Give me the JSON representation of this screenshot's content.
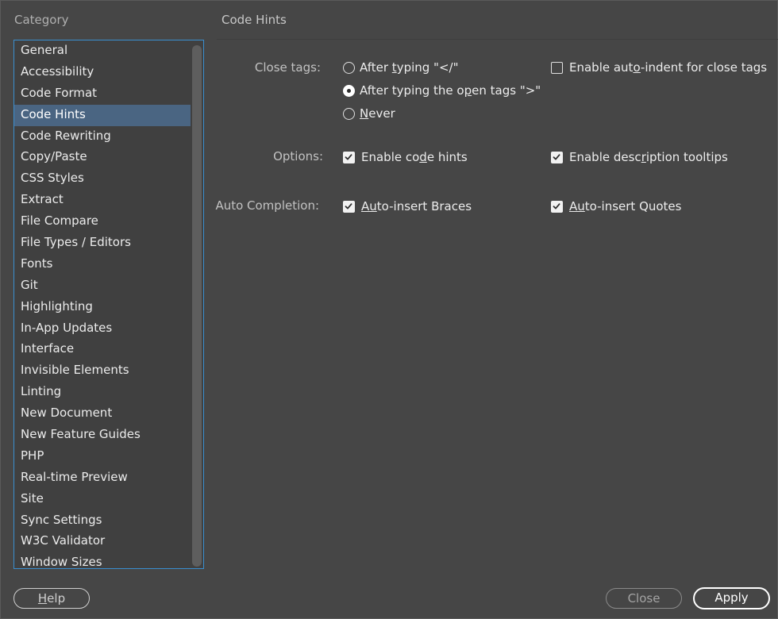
{
  "category_header": "Category",
  "section_title": "Code Hints",
  "categories": [
    "General",
    "Accessibility",
    "Code Format",
    "Code Hints",
    "Code Rewriting",
    "Copy/Paste",
    "CSS Styles",
    "Extract",
    "File Compare",
    "File Types / Editors",
    "Fonts",
    "Git",
    "Highlighting",
    "In-App Updates",
    "Interface",
    "Invisible Elements",
    "Linting",
    "New Document",
    "New Feature Guides",
    "PHP",
    "Real-time Preview",
    "Site",
    "Sync Settings",
    "W3C Validator",
    "Window Sizes"
  ],
  "selected_category": "Code Hints",
  "close_tags": {
    "label": "Close tags:",
    "opt1": {
      "pre": "After ",
      "u": "t",
      "post": "yping \"</\"",
      "checked": false
    },
    "opt2": {
      "pre": "After typing the o",
      "u": "p",
      "post": "en tags \">\"",
      "checked": true
    },
    "opt3": {
      "pre": "",
      "u": "N",
      "post": "ever",
      "checked": false
    },
    "auto_indent": {
      "pre": "Enable aut",
      "u": "o",
      "post": "-indent for close tags",
      "checked": false
    }
  },
  "options": {
    "label": "Options:",
    "code_hints": {
      "pre": "Enable co",
      "u": "d",
      "post": "e hints",
      "checked": true
    },
    "desc_tooltips": {
      "pre": "Enable desc",
      "u": "r",
      "post": "iption tooltips",
      "checked": true
    }
  },
  "auto_completion": {
    "label": "Auto Completion:",
    "braces": {
      "pre": "",
      "u": "Au",
      "post": "to-insert Braces",
      "checked": true
    },
    "quotes": {
      "pre": "",
      "u": "Au",
      "post": "to-insert Quotes",
      "checked": true
    }
  },
  "buttons": {
    "help": {
      "pre": "",
      "u": "H",
      "post": "elp"
    },
    "close": "Close",
    "apply": "Apply"
  }
}
